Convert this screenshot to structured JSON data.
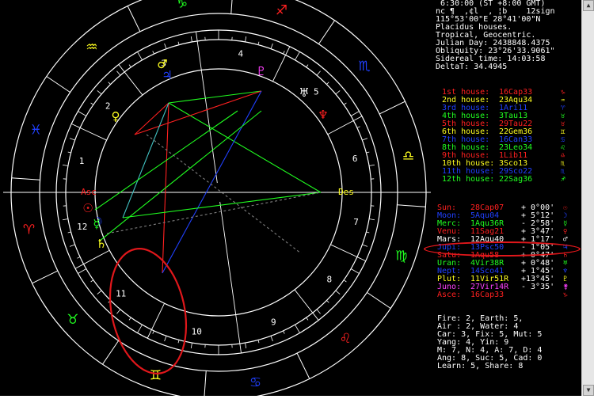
{
  "header_lines": [
    " 6:30:00 (ST +8:00 GMT)",
    "nc ¶  ,¢l  , ¦b    12sign",
    "115°53'00\"E 28°41'00\"N",
    "Placidus houses.",
    "Tropical, Geocentric.",
    "Julian Day: 2438848.4375",
    "Obliquity: 23°26'33.9061\"",
    "Sidereal time: 14:03:58",
    "DeltaT: 34.4945"
  ],
  "houses": [
    {
      "label": "1st house:",
      "value": "16Cap33",
      "color": "#ff2020",
      "glyph": "♑"
    },
    {
      "label": "2nd house:",
      "value": "23Aqu34",
      "color": "#ffff20",
      "glyph": "♒"
    },
    {
      "label": "3rd house:",
      "value": "1Ari11",
      "color": "#2040ff",
      "glyph": "♈"
    },
    {
      "label": "4th house:",
      "value": "3Tau13",
      "color": "#20ff20",
      "glyph": "♉"
    },
    {
      "label": "5th house:",
      "value": "29Tau22",
      "color": "#ff2020",
      "glyph": "♉"
    },
    {
      "label": "6th house:",
      "value": "22Gem36",
      "color": "#ffff20",
      "glyph": "♊"
    },
    {
      "label": "7th house:",
      "value": "16Can33",
      "color": "#2040ff",
      "glyph": "♋"
    },
    {
      "label": "8th house:",
      "value": "23Leo34",
      "color": "#20ff20",
      "glyph": "♌"
    },
    {
      "label": "9th house:",
      "value": "1Lib11",
      "color": "#ff2020",
      "glyph": "♎"
    },
    {
      "label": "10th house:",
      "value": "3Sco13",
      "color": "#ffff20",
      "glyph": "♏"
    },
    {
      "label": "11th house:",
      "value": "29Sco22",
      "color": "#2040ff",
      "glyph": "♏"
    },
    {
      "label": "12th house:",
      "value": "22Sag36",
      "color": "#20ff20",
      "glyph": "♐"
    }
  ],
  "planets": [
    {
      "label": "Sun:",
      "value": "28Cap07",
      "delta": "+ 0°00'",
      "color": "#ff2020",
      "glyph": "☉"
    },
    {
      "label": "Moon:",
      "value": "5Aqu04",
      "delta": "+ 5°12'",
      "color": "#2040ff",
      "glyph": "☽"
    },
    {
      "label": "Merc:",
      "value": "1Aqu36R",
      "delta": "- 2°58'",
      "color": "#20ff20",
      "glyph": "☿"
    },
    {
      "label": "Venu:",
      "value": "11Sag21",
      "delta": "+ 3°47'",
      "color": "#ff2020",
      "glyph": "♀"
    },
    {
      "label": "Mars:",
      "value": "12Aqu40",
      "delta": "+ 1°17'",
      "color": "#ffffff",
      "glyph": "♂"
    },
    {
      "label": "Jupi:",
      "value": "13Psc50",
      "delta": "- 1°05'",
      "color": "#2040ff",
      "glyph": "♃"
    },
    {
      "label": "Satu:",
      "value": "1Aqu58",
      "delta": "+ 0°47'",
      "color": "#ff2020",
      "glyph": "♄"
    },
    {
      "label": "Uran:",
      "value": "4Vir38R",
      "delta": "+ 0°48'",
      "color": "#20ff20",
      "glyph": "♅"
    },
    {
      "label": "Nept:",
      "value": "14Sco41",
      "delta": "+ 1°45'",
      "color": "#2040ff",
      "glyph": "♆"
    },
    {
      "label": "Plut:",
      "value": "11Vir51R",
      "delta": "+13°45'",
      "color": "#ffff20",
      "glyph": "♇"
    },
    {
      "label": "Juno:",
      "value": "27Vir14R",
      "delta": "- 3°35'",
      "color": "#ff40ff",
      "glyph": "⚵"
    },
    {
      "label": "Asce:",
      "value": "16Cap33",
      "delta": "",
      "color": "#ff2020",
      "glyph": "♑"
    }
  ],
  "summary_lines": [
    "Fire: 2, Earth: 5,",
    "Air : 2, Water: 4",
    "Car: 3, Fix: 5, Mut: 5",
    "Yang: 4, Yin: 9",
    "M: 7, N: 4, A: 7, D: 4",
    "Ang: 8, Suc: 5, Cad: 0",
    "Learn: 5, Share: 8"
  ],
  "wheel": {
    "center_labels": [
      "Asc",
      "Des",
      "MC",
      "IC"
    ],
    "house_numbers": [
      "1",
      "2",
      "3",
      "4",
      "5",
      "6",
      "7",
      "8",
      "9",
      "10",
      "11",
      "12"
    ],
    "sign_glyphs": [
      "♈",
      "♉",
      "♊",
      "♋",
      "♌",
      "♍",
      "♎",
      "♏",
      "♐",
      "♑",
      "♒",
      "♓"
    ],
    "sign_colors": [
      "#ff2020",
      "#20ff20",
      "#ffff20",
      "#2040ff",
      "#ff2020",
      "#20ff20",
      "#ffff20",
      "#2040ff",
      "#ff2020",
      "#20ff20",
      "#ffff20",
      "#2040ff"
    ]
  },
  "colors": {
    "background": "#000000",
    "ring": "#ffffff",
    "highlight": "#e0171b"
  }
}
